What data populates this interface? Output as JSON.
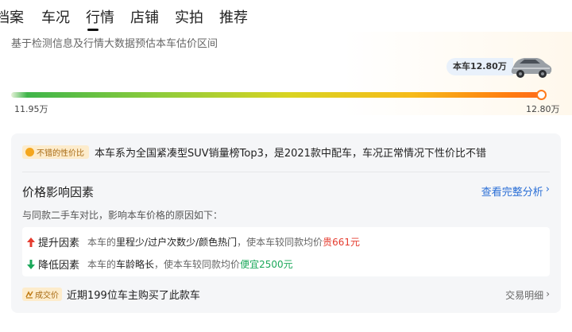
{
  "tabs": [
    "档案",
    "车况",
    "行情",
    "店铺",
    "实拍",
    "推荐"
  ],
  "price_range": {
    "description": "基于检测信息及行情大数据预估本车估价区间",
    "min_label": "11.95万",
    "max_label": "12.80万",
    "this_car_label": "本车12.80万",
    "position": 1.0
  },
  "card": {
    "badge": "不错的性价比",
    "tagline": "本车系为全国紧凑型SUV销量榜Top3，是2021款中配车，车况正常情况下性价比不错",
    "section_title": "价格影响因素",
    "view_link": "查看完整分析",
    "subtitle": "与同款二手车对比，影响本车价格的原因如下：",
    "factor_up": {
      "name": "提升因素",
      "text1": "本车的",
      "highlight": "里程少/过户次数少/颜色热门",
      "text2": "，使本车较同款均价",
      "result": "贵661元"
    },
    "factor_down": {
      "name": "降低因素",
      "text1": "本车的",
      "highlight": "车龄略长",
      "text2": "，使本车较同款均价",
      "result": "便宜2500元"
    },
    "deal_badge": "成交价",
    "deal_text": "近期199位车主购买了此款车",
    "deal_link": "交易明细"
  },
  "colors": {
    "accent_blue": "#2b6fd6",
    "up_red": "#e53b2e",
    "down_green": "#1ba85a",
    "marker_orange": "#ff7a1a"
  }
}
